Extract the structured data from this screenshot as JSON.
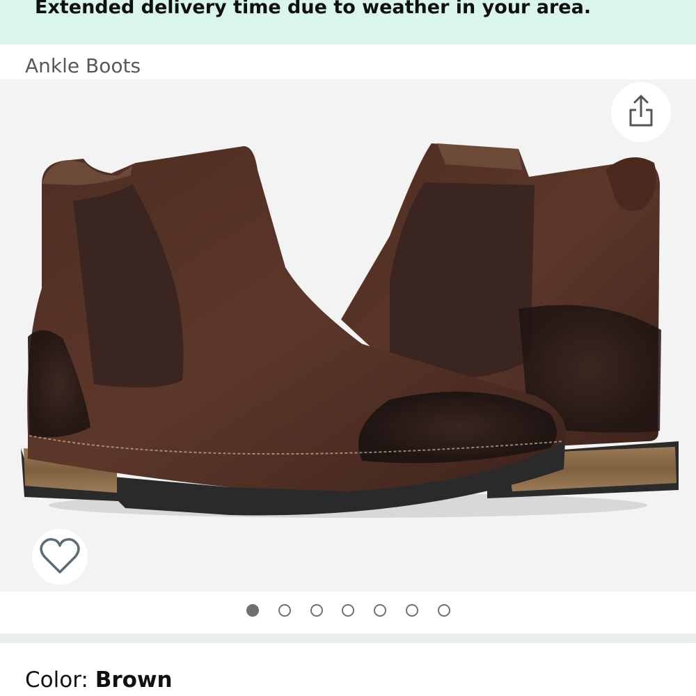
{
  "banner": {
    "text": "Extended delivery time due to weather in your area."
  },
  "breadcrumb": {
    "label": "Ankle Boots"
  },
  "gallery": {
    "image_count": 7,
    "active_index": 0,
    "share_icon": "share-icon",
    "wishlist_icon": "heart-icon"
  },
  "product": {
    "color_label": "Color: ",
    "color_value": "Brown"
  },
  "colors": {
    "banner_bg": "#d9f5ec",
    "gallery_bg": "#f3f3f3",
    "divider": "#eaeded",
    "suede": "#4a2a1f",
    "sole": "#8b6a47"
  }
}
